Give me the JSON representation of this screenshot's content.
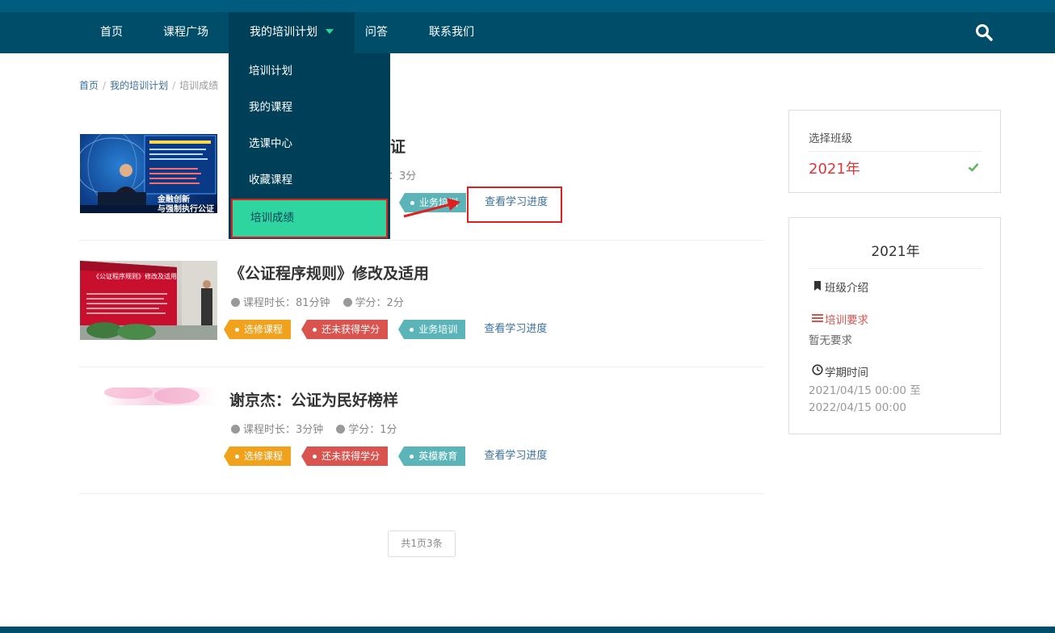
{
  "nav": {
    "items": [
      "首页",
      "课程广场",
      "我的培训计划",
      "问答",
      "联系我们"
    ],
    "active_index": 2
  },
  "dropdown": {
    "items": [
      "培训计划",
      "我的课程",
      "选课中心",
      "收藏课程",
      "培训成绩"
    ],
    "highlighted_index": 4
  },
  "breadcrumb": [
    "首页",
    "我的培训计划",
    "培训成绩"
  ],
  "courses": [
    {
      "title_visible": "证",
      "meta_visible": "：3分",
      "tags": [
        {
          "label": "业务培训",
          "color": "teal"
        }
      ],
      "progress_link": "查看学习进度",
      "thumb_text": [
        "金融创新",
        "与强制执行公证"
      ]
    },
    {
      "title": "《公证程序规则》修改及适用",
      "duration_label": "课程时长：81分钟",
      "credit_label": "学分：2分",
      "tags": [
        {
          "label": "选修课程",
          "color": "orange"
        },
        {
          "label": "还未获得学分",
          "color": "red"
        },
        {
          "label": "业务培训",
          "color": "teal"
        }
      ],
      "progress_link": "查看学习进度",
      "thumb_text": [
        "《公证程序规则》修改及适用"
      ]
    },
    {
      "title": "谢京杰：公证为民好榜样",
      "duration_label": "课程时长：3分钟",
      "credit_label": "学分：1分",
      "tags": [
        {
          "label": "选修课程",
          "color": "orange"
        },
        {
          "label": "还未获得学分",
          "color": "red"
        },
        {
          "label": "英模教育",
          "color": "teal"
        }
      ],
      "progress_link": "查看学习进度"
    }
  ],
  "pager": {
    "label": "共1页3条"
  },
  "side_panel_class": {
    "label": "选择班级",
    "selected_year": "2021年"
  },
  "side_panel_info": {
    "title": "2021年",
    "intro_heading": "班级介绍",
    "requirement_heading": "培训要求",
    "requirement_text": "暂无要求",
    "term_heading": "学期时间",
    "term_dates": "2021/04/15  00:00  至  2022/04/15 00:00"
  },
  "colors": {
    "nav_bg": "#004d6a",
    "dropdown_bg": "#003f58",
    "highlight_green": "#2ed59f",
    "annotation_red": "#e02020",
    "tag_orange": "#f0a21c",
    "tag_red": "#d9534f",
    "tag_teal": "#5bb5b8",
    "link_blue": "#3a6f9a"
  },
  "icons": [
    "search-icon",
    "caret-down-icon",
    "bookmark-icon",
    "list-icon",
    "clock-icon",
    "check-icon",
    "arrow-annotation-icon"
  ]
}
